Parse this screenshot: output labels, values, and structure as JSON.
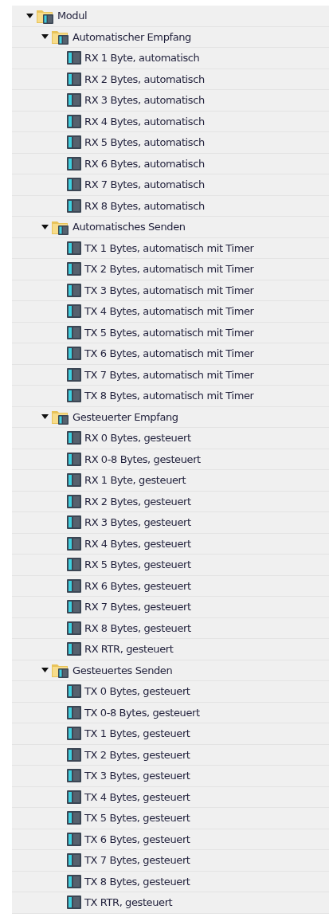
{
  "tree": [
    {
      "label": "Modul",
      "kind": "folder",
      "expanded": true,
      "children": [
        {
          "label": "Automatischer Empfang",
          "kind": "folder",
          "expanded": true,
          "children": [
            {
              "label": "RX 1 Byte, automatisch",
              "kind": "module"
            },
            {
              "label": "RX 2 Bytes, automatisch",
              "kind": "module"
            },
            {
              "label": "RX 3 Bytes, automatisch",
              "kind": "module"
            },
            {
              "label": "RX 4 Bytes, automatisch",
              "kind": "module"
            },
            {
              "label": "RX 5 Bytes, automatisch",
              "kind": "module"
            },
            {
              "label": "RX 6 Bytes, automatisch",
              "kind": "module"
            },
            {
              "label": "RX 7 Bytes, automatisch",
              "kind": "module"
            },
            {
              "label": "RX 8 Bytes, automatisch",
              "kind": "module"
            }
          ]
        },
        {
          "label": "Automatisches Senden",
          "kind": "folder",
          "expanded": true,
          "children": [
            {
              "label": "TX 1 Bytes, automatisch mit Timer",
              "kind": "module"
            },
            {
              "label": "TX 2 Bytes, automatisch mit Timer",
              "kind": "module"
            },
            {
              "label": "TX 3 Bytes, automatisch mit Timer",
              "kind": "module"
            },
            {
              "label": "TX 4 Bytes, automatisch mit Timer",
              "kind": "module"
            },
            {
              "label": "TX 5 Bytes, automatisch mit Timer",
              "kind": "module"
            },
            {
              "label": "TX 6 Bytes, automatisch mit Timer",
              "kind": "module"
            },
            {
              "label": "TX 7 Bytes, automatisch mit Timer",
              "kind": "module"
            },
            {
              "label": "TX 8 Bytes, automatisch mit Timer",
              "kind": "module"
            }
          ]
        },
        {
          "label": "Gesteuerter Empfang",
          "kind": "folder",
          "expanded": true,
          "children": [
            {
              "label": "RX 0 Bytes, gesteuert",
              "kind": "module"
            },
            {
              "label": "RX 0-8 Bytes, gesteuert",
              "kind": "module"
            },
            {
              "label": "RX 1 Byte, gesteuert",
              "kind": "module"
            },
            {
              "label": "RX 2 Bytes, gesteuert",
              "kind": "module"
            },
            {
              "label": "RX 3 Bytes, gesteuert",
              "kind": "module"
            },
            {
              "label": "RX 4 Bytes, gesteuert",
              "kind": "module"
            },
            {
              "label": "RX 5 Bytes, gesteuert",
              "kind": "module"
            },
            {
              "label": "RX 6 Bytes, gesteuert",
              "kind": "module"
            },
            {
              "label": "RX 7 Bytes, gesteuert",
              "kind": "module"
            },
            {
              "label": "RX 8 Bytes, gesteuert",
              "kind": "module"
            },
            {
              "label": "RX RTR, gesteuert",
              "kind": "module"
            }
          ]
        },
        {
          "label": "Gesteuertes Senden",
          "kind": "folder",
          "expanded": true,
          "children": [
            {
              "label": "TX 0 Bytes, gesteuert",
              "kind": "module"
            },
            {
              "label": "TX 0-8 Bytes, gesteuert",
              "kind": "module"
            },
            {
              "label": "TX 1 Bytes, gesteuert",
              "kind": "module"
            },
            {
              "label": "TX 2 Bytes, gesteuert",
              "kind": "module"
            },
            {
              "label": "TX 3 Bytes, gesteuert",
              "kind": "module"
            },
            {
              "label": "TX 4 Bytes, gesteuert",
              "kind": "module"
            },
            {
              "label": "TX 5 Bytes, gesteuert",
              "kind": "module"
            },
            {
              "label": "TX 6 Bytes, gesteuert",
              "kind": "module"
            },
            {
              "label": "TX 7 Bytes, gesteuert",
              "kind": "module"
            },
            {
              "label": "TX 8 Bytes, gesteuert",
              "kind": "module"
            },
            {
              "label": "TX RTR, gesteuert",
              "kind": "module"
            }
          ]
        }
      ]
    }
  ]
}
